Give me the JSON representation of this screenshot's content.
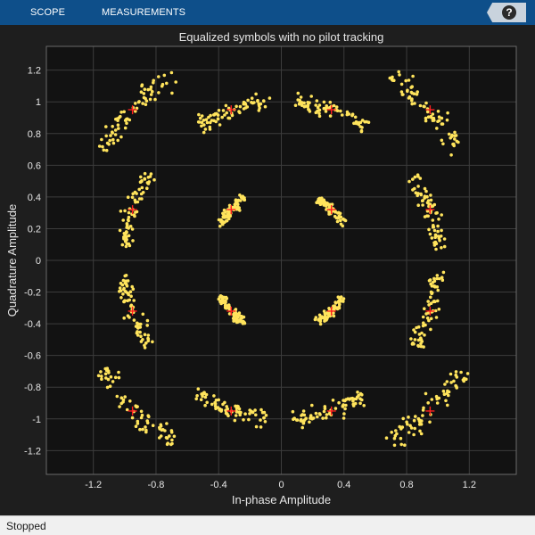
{
  "toolstrip": {
    "tabs": [
      {
        "label": "SCOPE"
      },
      {
        "label": "MEASUREMENTS"
      }
    ],
    "help_icon": "question-mark-icon",
    "help_symbol": "?"
  },
  "status": {
    "text": "Stopped"
  },
  "colors": {
    "toolstrip": "#0e4f8a",
    "background": "#1e1e1e",
    "axes_background": "#121212",
    "grid": "#3c3c3c",
    "axis_text": "#e6e6e6",
    "samples": "#ffe45c",
    "reference": "#ff2020"
  },
  "chart_data": {
    "type": "scatter",
    "title": "Equalized symbols with no pilot tracking",
    "xlabel": "In-phase Amplitude",
    "ylabel": "Quadrature Amplitude",
    "xlim": [
      -1.5,
      1.5
    ],
    "ylim": [
      -1.35,
      1.35
    ],
    "xticks": [
      -1.2,
      -0.8,
      -0.4,
      0,
      0.4,
      0.8,
      1.2
    ],
    "xtick_labels": [
      "-1.2",
      "-0.8",
      "-0.4",
      "0",
      "0.4",
      "0.8",
      "1.2"
    ],
    "yticks": [
      1.2,
      1,
      0.8,
      0.6,
      0.4,
      0.2,
      0,
      -0.2,
      -0.4,
      -0.6,
      -0.8,
      -1,
      -1.2
    ],
    "ytick_labels": [
      "1.2",
      "1",
      "0.8",
      "0.6",
      "0.4",
      "0.2",
      "0",
      "-0.2",
      "-0.4",
      "-0.6",
      "-0.8",
      "-1",
      "-1.2"
    ],
    "grid": true,
    "series": [
      {
        "role": "reference-constellation",
        "marker": "plus",
        "x": [
          -0.95,
          -0.32,
          0.32,
          0.95,
          -0.95,
          -0.32,
          0.32,
          0.95,
          -0.95,
          -0.32,
          0.32,
          0.95,
          -0.95,
          -0.32,
          0.32,
          0.95
        ],
        "y": [
          0.95,
          0.95,
          0.95,
          0.95,
          0.32,
          0.32,
          0.32,
          0.32,
          -0.32,
          -0.32,
          -0.32,
          -0.32,
          -0.95,
          -0.95,
          -0.95,
          -0.95
        ]
      },
      {
        "role": "received-symbols",
        "marker": "dot",
        "clusters": [
          {
            "center": [
              -0.95,
              0.95
            ],
            "rotation_deg": [
              -14,
              14
            ],
            "count": 70
          },
          {
            "center": [
              -0.32,
              0.95
            ],
            "rotation_deg": [
              -14,
              14
            ],
            "count": 70
          },
          {
            "center": [
              0.32,
              0.95
            ],
            "rotation_deg": [
              -14,
              14
            ],
            "count": 70
          },
          {
            "center": [
              0.95,
              0.95
            ],
            "rotation_deg": [
              -14,
              14
            ],
            "count": 70
          },
          {
            "center": [
              -0.95,
              0.32
            ],
            "rotation_deg": [
              -14,
              14
            ],
            "count": 70
          },
          {
            "center": [
              -0.32,
              0.32
            ],
            "rotation_deg": [
              -14,
              14
            ],
            "count": 70
          },
          {
            "center": [
              0.32,
              0.32
            ],
            "rotation_deg": [
              -14,
              14
            ],
            "count": 70
          },
          {
            "center": [
              0.95,
              0.32
            ],
            "rotation_deg": [
              -14,
              14
            ],
            "count": 70
          },
          {
            "center": [
              -0.95,
              -0.32
            ],
            "rotation_deg": [
              -14,
              14
            ],
            "count": 70
          },
          {
            "center": [
              -0.32,
              -0.32
            ],
            "rotation_deg": [
              -14,
              14
            ],
            "count": 70
          },
          {
            "center": [
              0.32,
              -0.32
            ],
            "rotation_deg": [
              -14,
              14
            ],
            "count": 70
          },
          {
            "center": [
              0.95,
              -0.32
            ],
            "rotation_deg": [
              -14,
              14
            ],
            "count": 70
          },
          {
            "center": [
              -0.95,
              -0.95
            ],
            "rotation_deg": [
              -14,
              14
            ],
            "count": 70
          },
          {
            "center": [
              -0.32,
              -0.95
            ],
            "rotation_deg": [
              -14,
              14
            ],
            "count": 70
          },
          {
            "center": [
              0.32,
              -0.95
            ],
            "rotation_deg": [
              -14,
              14
            ],
            "count": 70
          },
          {
            "center": [
              0.95,
              -0.95
            ],
            "rotation_deg": [
              -14,
              14
            ],
            "count": 70
          }
        ]
      }
    ]
  }
}
